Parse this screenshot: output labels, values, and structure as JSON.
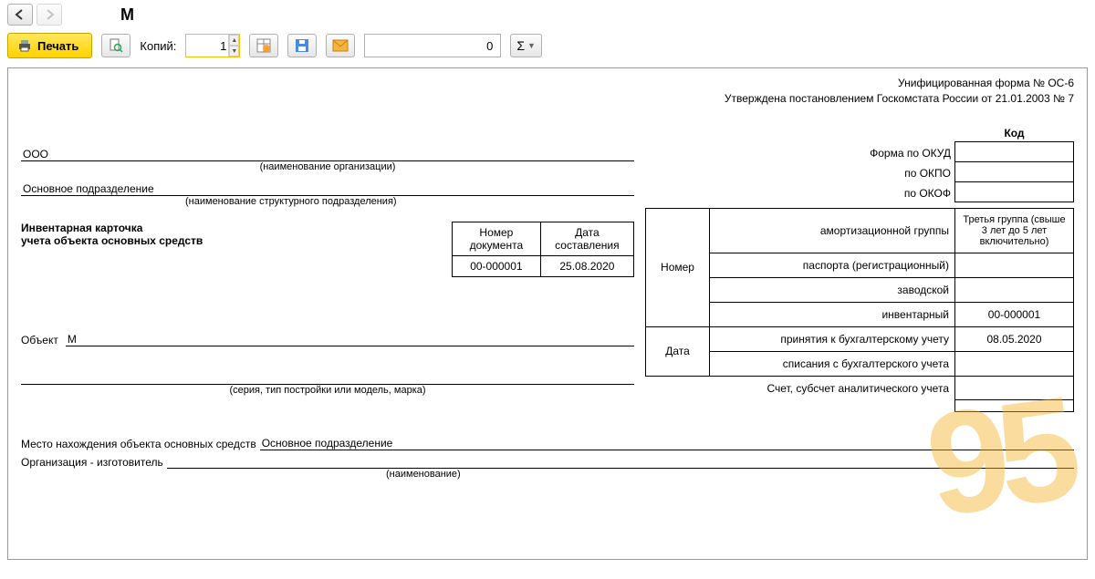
{
  "nav": {
    "title": "М"
  },
  "toolbar": {
    "print_label": "Печать",
    "copies_label": "Копий:",
    "copies_value": "1",
    "num_field": "0",
    "sigma": "Σ"
  },
  "form_header": {
    "line1": "Унифицированная форма № ОС-6",
    "line2": "Утверждена постановлением Госкомстата России от 21.01.2003 № 7"
  },
  "org": {
    "value": "ООО",
    "caption": "(наименование организации)"
  },
  "dept": {
    "value": "Основное подразделение",
    "caption": "(наименование структурного подразделения)"
  },
  "card_title": {
    "l1": "Инвентарная карточка",
    "l2": "учета объекта основных средств"
  },
  "doc_meta": {
    "num_header": "Номер документа",
    "date_header": "Дата составления",
    "num_value": "00-000001",
    "date_value": "25.08.2020"
  },
  "object": {
    "label": "Объект",
    "value": "М",
    "caption2": "(серия, тип постройки или модель, марка)"
  },
  "kod_header": "Код",
  "kod_rows": {
    "okud": "Форма по ОКУД",
    "okpo": "по ОКПО",
    "okof": "по ОКОФ"
  },
  "big_rows": {
    "nomer_label": "Номер",
    "amort": "амортизационной группы",
    "amort_val": "Третья группа (свыше 3 лет до 5 лет включительно)",
    "passport": "паспорта (регистрационный)",
    "factory": "заводской",
    "inventory": "инвентарный",
    "inventory_val": "00-000001",
    "date_label": "Дата",
    "accept": "принятия к бухгалтерскому учету",
    "accept_val": "08.05.2020",
    "writeoff": "списания с бухгалтерского учета",
    "account_row": "Счет, субсчет аналитического учета"
  },
  "location": {
    "label": "Место нахождения объекта основных средств",
    "value": "Основное подразделение"
  },
  "manufacturer": {
    "label": "Организация - изготовитель",
    "caption": "(наименование)"
  },
  "watermark": "95"
}
